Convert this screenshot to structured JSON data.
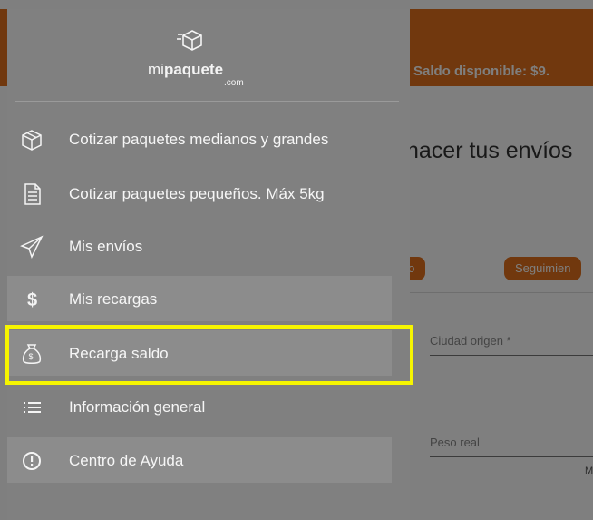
{
  "topbar": {
    "saldo_label": "Saldo disponible: $9."
  },
  "main": {
    "heading": "hacer tus envíos",
    "pills": [
      "ino",
      "Seguimien"
    ],
    "fields": [
      "Ciudad origen *",
      "Peso real"
    ],
    "mini": "M"
  },
  "drawer": {
    "logo": {
      "part1": "mi",
      "part2": "paquete",
      "suffix": ".com"
    },
    "items": [
      {
        "label": "Cotizar paquetes medianos y grandes",
        "icon": "cube-icon"
      },
      {
        "label": "Cotizar paquetes pequeños. Máx 5kg",
        "icon": "document-icon"
      },
      {
        "label": "Mis envíos",
        "icon": "paper-plane-icon"
      },
      {
        "label": "Mis recargas",
        "icon": "dollar-icon"
      },
      {
        "label": "Recarga saldo",
        "icon": "money-bag-icon"
      },
      {
        "label": "Información general",
        "icon": "list-icon"
      },
      {
        "label": "Centro de Ayuda",
        "icon": "help-alert-icon"
      }
    ]
  },
  "colors": {
    "accent": "#e2711d",
    "highlight": "#f6f500",
    "drawer": "#808080"
  }
}
